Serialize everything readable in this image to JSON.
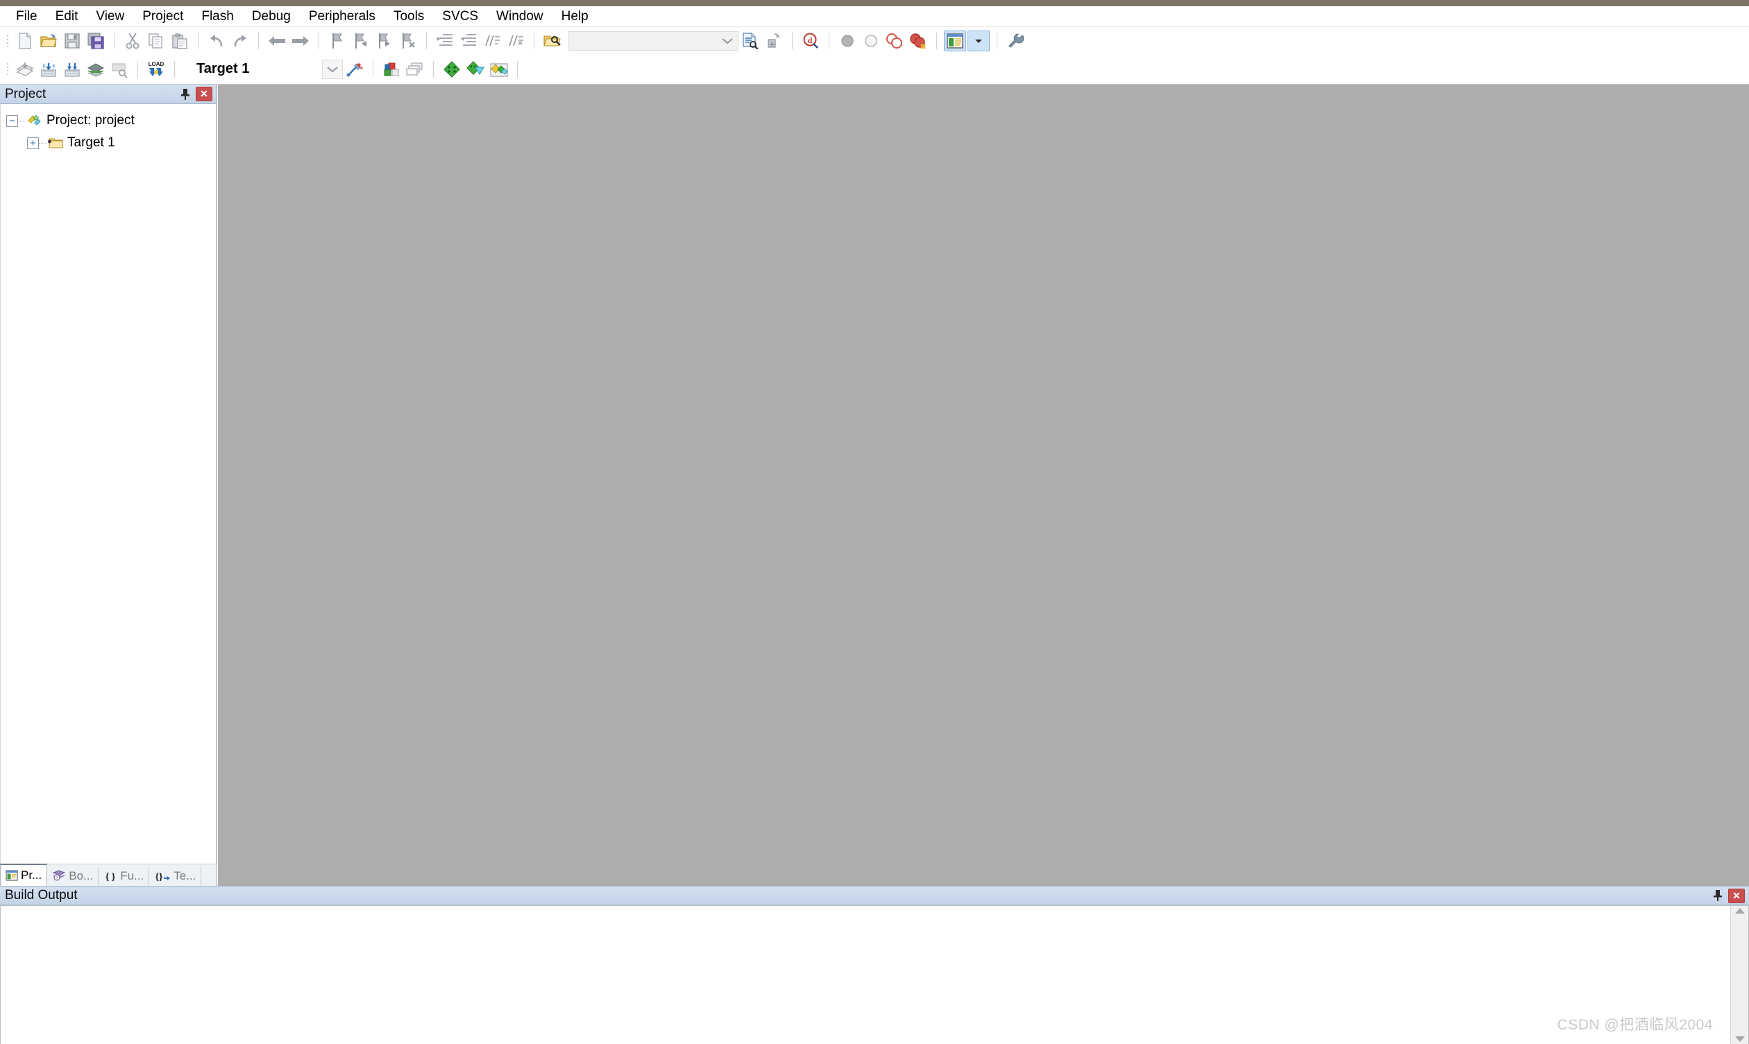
{
  "window": {
    "titlebar_color": "#7d7668",
    "editor_background": "#adadad"
  },
  "menubar": {
    "items": [
      {
        "label": "File"
      },
      {
        "label": "Edit"
      },
      {
        "label": "View"
      },
      {
        "label": "Project"
      },
      {
        "label": "Flash"
      },
      {
        "label": "Debug"
      },
      {
        "label": "Peripherals"
      },
      {
        "label": "Tools"
      },
      {
        "label": "SVCS"
      },
      {
        "label": "Window"
      },
      {
        "label": "Help"
      }
    ]
  },
  "toolbar_main": {
    "buttons": [
      {
        "name": "new-file-icon",
        "title": "New"
      },
      {
        "name": "open-file-icon",
        "title": "Open"
      },
      {
        "name": "save-icon",
        "title": "Save"
      },
      {
        "name": "save-all-icon",
        "title": "Save All"
      },
      {
        "name": "cut-icon",
        "title": "Cut"
      },
      {
        "name": "copy-icon",
        "title": "Copy"
      },
      {
        "name": "paste-icon",
        "title": "Paste"
      },
      {
        "name": "undo-icon",
        "title": "Undo"
      },
      {
        "name": "redo-icon",
        "title": "Redo"
      },
      {
        "name": "navigate-back-icon",
        "title": "Back"
      },
      {
        "name": "navigate-forward-icon",
        "title": "Forward"
      },
      {
        "name": "bookmark-toggle-icon",
        "title": "Insert/Remove Bookmark"
      },
      {
        "name": "bookmark-prev-icon",
        "title": "Previous Bookmark"
      },
      {
        "name": "bookmark-next-icon",
        "title": "Next Bookmark"
      },
      {
        "name": "bookmark-clear-icon",
        "title": "Clear All Bookmarks"
      },
      {
        "name": "indent-icon",
        "title": "Indent"
      },
      {
        "name": "outdent-icon",
        "title": "Outdent"
      },
      {
        "name": "comment-icon",
        "title": "Comment"
      },
      {
        "name": "uncomment-icon",
        "title": "Uncomment"
      },
      {
        "name": "find-in-files-icon",
        "title": "Find in Files"
      }
    ],
    "search_combo": {
      "value": "",
      "placeholder": "",
      "arrow_icon": "chevron-down-icon"
    },
    "right_buttons": [
      {
        "name": "browse-symbols-icon",
        "title": "Browse Symbols"
      },
      {
        "name": "insert-file-icon",
        "title": "Insert File"
      },
      {
        "name": "debug-find-icon",
        "title": "Find"
      },
      {
        "name": "breakpoint-insert-icon",
        "title": "Insert/Remove Breakpoint"
      },
      {
        "name": "breakpoint-enable-icon",
        "title": "Enable/Disable Breakpoint"
      },
      {
        "name": "breakpoint-disable-all-icon",
        "title": "Disable All Breakpoints"
      },
      {
        "name": "breakpoint-kill-all-icon",
        "title": "Kill All Breakpoints"
      },
      {
        "name": "window-layout-icon",
        "title": "Window Layout",
        "active": true
      },
      {
        "name": "layout-dropdown-icon",
        "title": "Layout Menu",
        "active": true
      },
      {
        "name": "configure-icon",
        "title": "Configuration Wizard"
      }
    ]
  },
  "toolbar_build": {
    "buttons": [
      {
        "name": "translate-file-icon",
        "title": "Translate"
      },
      {
        "name": "build-target-icon",
        "title": "Build"
      },
      {
        "name": "rebuild-all-icon",
        "title": "Rebuild All"
      },
      {
        "name": "batch-build-icon",
        "title": "Batch Build"
      },
      {
        "name": "clean-target-icon",
        "title": "Clean Target"
      },
      {
        "name": "download-load-icon",
        "title": "Download",
        "caption": "LOAD"
      }
    ],
    "target_selector": {
      "value": "Target 1",
      "arrow_icon": "chevron-down-icon"
    },
    "right_buttons": [
      {
        "name": "target-options-icon",
        "title": "Options for Target"
      },
      {
        "name": "manage-project-items-icon",
        "title": "Manage Project Items"
      },
      {
        "name": "multi-project-icon",
        "title": "Manage Multi-Project"
      },
      {
        "name": "pack-installer-icon",
        "title": "Pack Installer"
      },
      {
        "name": "select-software-packs-icon",
        "title": "Select Software Packs"
      },
      {
        "name": "manage-runtime-env-icon",
        "title": "Manage Run-Time Environment"
      }
    ]
  },
  "project_panel": {
    "title": "Project",
    "pin_icon": "pin-icon",
    "close_icon": "close-icon",
    "tree": [
      {
        "label": "Project: project",
        "expander": "−",
        "icon": "project-icon",
        "level": 0
      },
      {
        "label": "Target 1",
        "expander": "+",
        "icon": "target-folder-icon",
        "level": 1
      }
    ],
    "tabs": [
      {
        "label": "Pr...",
        "full": "Project",
        "icon": "project-tab-icon",
        "selected": true
      },
      {
        "label": "Bo...",
        "full": "Books",
        "icon": "books-tab-icon",
        "selected": false
      },
      {
        "label": "Fu...",
        "full": "Functions",
        "icon": "functions-tab-icon",
        "selected": false
      },
      {
        "label": "Te...",
        "full": "Templates",
        "icon": "templates-tab-icon",
        "selected": false
      }
    ]
  },
  "build_output": {
    "title": "Build Output",
    "pin_icon": "pin-icon",
    "close_icon": "close-icon",
    "content": "",
    "scroll_up_icon": "scroll-up-arrow-icon",
    "scroll_down_icon": "scroll-down-arrow-icon"
  },
  "watermark": {
    "text": "CSDN @把酒临风2004"
  }
}
